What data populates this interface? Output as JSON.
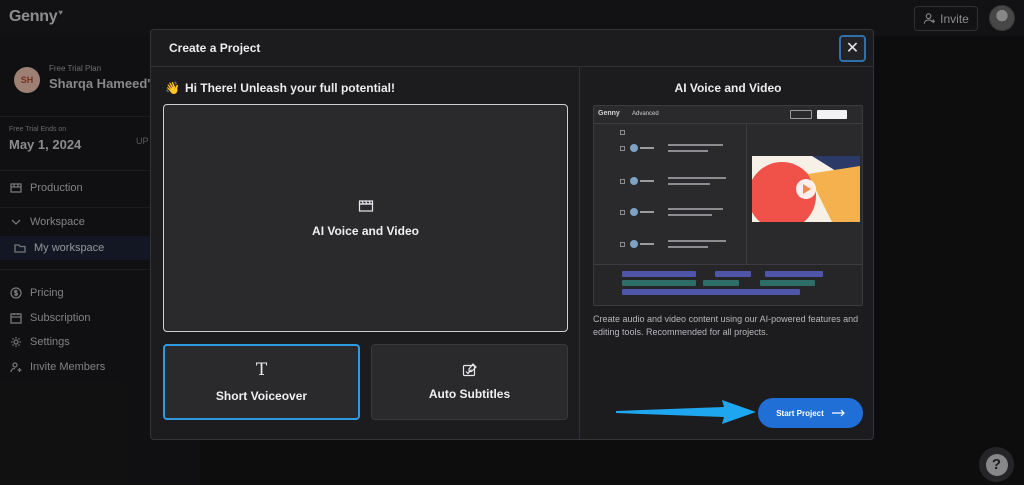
{
  "app": {
    "logo": "Genny",
    "invite_label": "Invite"
  },
  "sidebar": {
    "plan_label": "Free Trial Plan",
    "user_name": "Sharqa Hameed'...",
    "user_initials": "SH",
    "trial_label": "Free Trial Ends on",
    "trial_date": "May 1, 2024",
    "upgrade_partial": "UP",
    "items": [
      {
        "label": "Production",
        "icon": "film-icon"
      },
      {
        "label": "Workspace",
        "icon": "chevron-down-icon"
      },
      {
        "label": "My workspace",
        "icon": "folder-icon"
      },
      {
        "label": "Pricing",
        "icon": "dollar-icon"
      },
      {
        "label": "Subscription",
        "icon": "calendar-icon"
      },
      {
        "label": "Settings",
        "icon": "gear-icon"
      },
      {
        "label": "Invite Members",
        "icon": "add-user-icon"
      }
    ]
  },
  "modal": {
    "title": "Create a Project",
    "greeting": "Hi There! Unleash your full potential!",
    "greeting_icon": "wave-hand-icon",
    "options": {
      "main": "AI Voice and Video",
      "short_voiceover": "Short Voiceover",
      "auto_subtitles": "Auto Subtitles"
    },
    "preview": {
      "title": "AI Voice and Video",
      "logo": "Genny",
      "tab": "Advanced",
      "description": "Create audio and video content using our AI-powered features and editing tools. Recommended for all projects."
    },
    "start_label": "Start Project"
  },
  "colors": {
    "accent": "#1f6fd6",
    "selected_border": "#2e9be0",
    "annotation_arrow": "#1ea7f0"
  }
}
